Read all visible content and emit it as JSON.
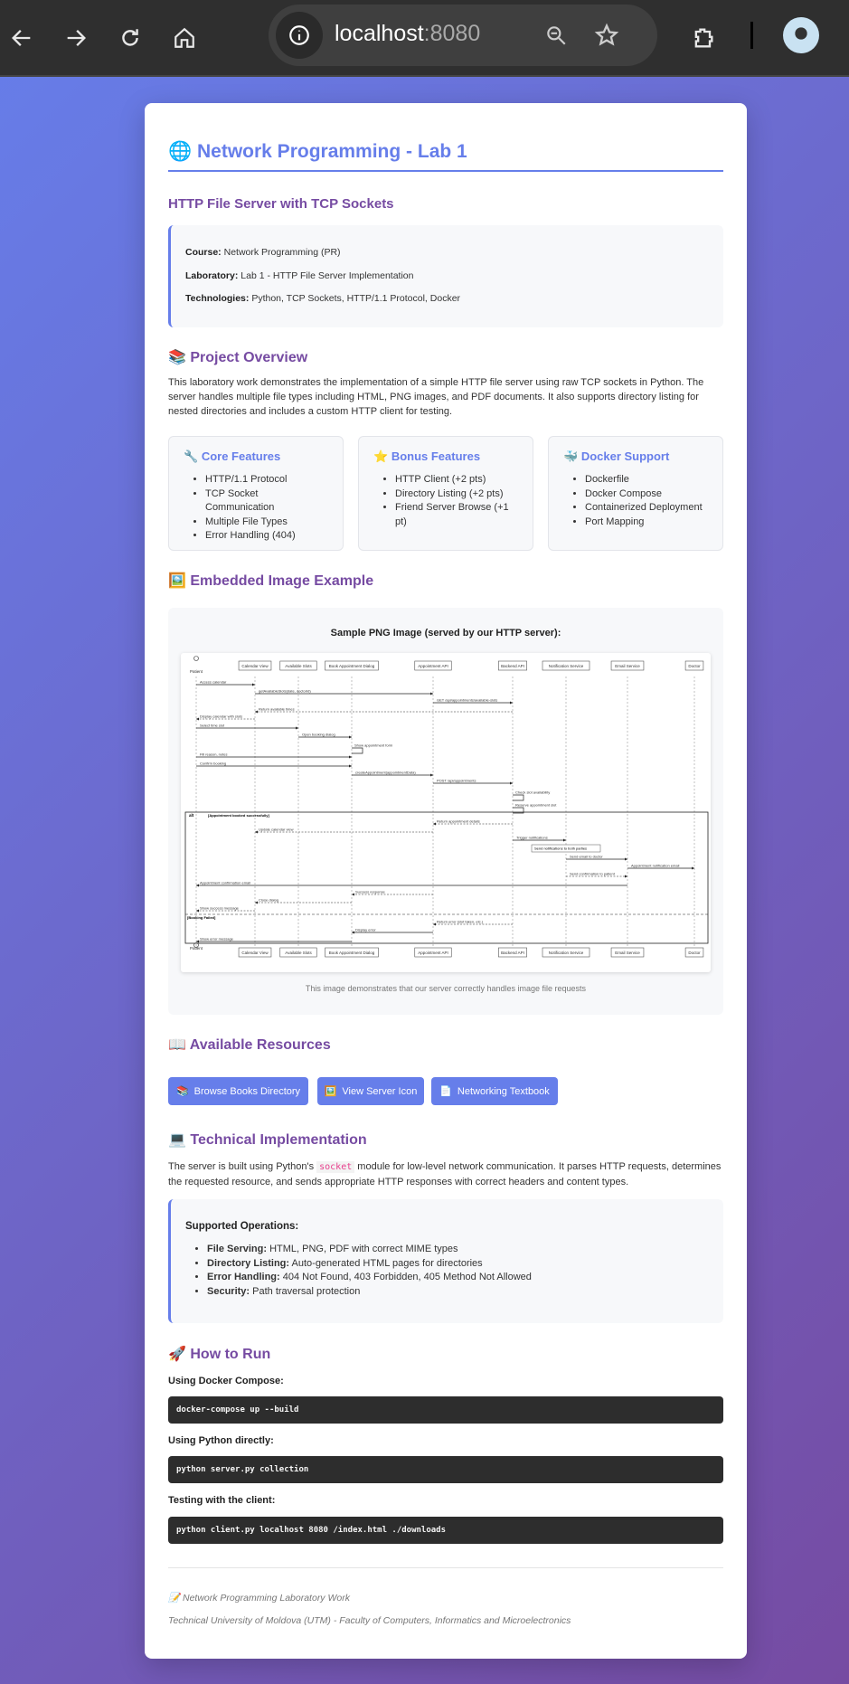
{
  "browser": {
    "url_host": "localhost",
    "url_port": ":8080"
  },
  "header": {
    "icon": "🌐",
    "title": "Network Programming - Lab 1",
    "subtitle": "HTTP File Server with TCP Sockets"
  },
  "info": [
    {
      "k": "Course:",
      "v": " Network Programming (PR)"
    },
    {
      "k": "Laboratory:",
      "v": " Lab 1 - HTTP File Server Implementation"
    },
    {
      "k": "Technologies:",
      "v": " Python, TCP Sockets, HTTP/1.1 Protocol, Docker"
    }
  ],
  "overview": {
    "icon": "📚",
    "title": "Project Overview",
    "text": "This laboratory work demonstrates the implementation of a simple HTTP file server using raw TCP sockets in Python. The server handles multiple file types including HTML, PNG images, and PDF documents. It also supports directory listing for nested directories and includes a custom HTTP client for testing."
  },
  "features": [
    {
      "icon": "🔧",
      "title": "Core Features",
      "items": [
        "HTTP/1.1 Protocol",
        "TCP Socket Communication",
        "Multiple File Types",
        "Error Handling (404)"
      ]
    },
    {
      "icon": "⭐",
      "title": "Bonus Features",
      "items": [
        "HTTP Client (+2 pts)",
        "Directory Listing (+2 pts)",
        "Friend Server Browse (+1 pt)"
      ]
    },
    {
      "icon": "🐳",
      "title": "Docker Support",
      "items": [
        "Dockerfile",
        "Docker Compose",
        "Containerized Deployment",
        "Port Mapping"
      ]
    }
  ],
  "embedded": {
    "icon": "🖼️",
    "title": "Embedded Image Example",
    "caption_title": "Sample PNG Image (served by our HTTP server):",
    "caption": "This image demonstrates that our server correctly handles image file requests"
  },
  "diagram": {
    "participants": [
      "Patient",
      "Calendar View",
      "Available Slots",
      "Book Appointment Dialog",
      "Appointment API",
      "Backend API",
      "Notification Service",
      "Email Service",
      "Doctor"
    ],
    "messages": [
      {
        "f": 0,
        "t": 1,
        "l": "Access calendar"
      },
      {
        "f": 1,
        "t": 4,
        "l": "getAvailableSlots(date, doctorId)"
      },
      {
        "f": 4,
        "t": 5,
        "l": "GET /api/appointments/available-slots"
      },
      {
        "f": 5,
        "t": 1,
        "l": "Return available times",
        "d": 1
      },
      {
        "f": 1,
        "t": 0,
        "l": "Display calendar with slots",
        "d": 1
      },
      {
        "f": 0,
        "t": 2,
        "l": "Select time slot"
      },
      {
        "f": 2,
        "t": 3,
        "l": "Open booking dialog"
      },
      {
        "f": 3,
        "t": 3,
        "l": "Show appointment form"
      },
      {
        "f": 0,
        "t": 3,
        "l": "Fill reason, notes"
      },
      {
        "f": 0,
        "t": 3,
        "l": "Confirm booking"
      },
      {
        "f": 3,
        "t": 4,
        "l": "createAppointment(appointmentData)"
      },
      {
        "f": 4,
        "t": 5,
        "l": "POST /api/appointments"
      },
      {
        "f": 5,
        "t": 5,
        "l": "Check slot availability"
      },
      {
        "f": 5,
        "t": 5,
        "l": "Reserve appointment slot"
      },
      {
        "f": 5,
        "t": 4,
        "l": "Return appointment details",
        "d": 1
      },
      {
        "f": 4,
        "t": 1,
        "l": "Update calendar view",
        "d": 1
      },
      {
        "f": 5,
        "t": 6,
        "l": "Trigger notifications"
      },
      {
        "f": 6,
        "t": 7,
        "l": "Send email to doctor"
      },
      {
        "f": 7,
        "t": 8,
        "l": "Appointment notification email"
      },
      {
        "f": 6,
        "t": 7,
        "l": "Send confirmation to patient",
        "d": 1
      },
      {
        "f": 7,
        "t": 0,
        "l": "Appointment confirmation email"
      },
      {
        "f": 4,
        "t": 3,
        "l": "Success response",
        "d": 1
      },
      {
        "f": 3,
        "t": 1,
        "l": "Close dialog",
        "d": 1
      },
      {
        "f": 1,
        "t": 0,
        "l": "Show success message",
        "d": 1
      },
      {
        "f": 5,
        "t": 4,
        "l": "Return error (slot taken, etc.)",
        "d": 1
      },
      {
        "f": 4,
        "t": 3,
        "l": "Display error"
      },
      {
        "f": 3,
        "t": 0,
        "l": "Show error message"
      }
    ],
    "alt_label": "alt",
    "alt_condition": "[Appointment booked successfully]",
    "else_condition": "[Booking Failed]",
    "note": "Send notifications to both parties"
  },
  "resources": {
    "icon": "📖",
    "title": "Available Resources",
    "buttons": [
      {
        "icon": "📚",
        "label": "Browse Books Directory"
      },
      {
        "icon": "🖼️",
        "label": "View Server Icon"
      },
      {
        "icon": "📄",
        "label": "Networking Textbook"
      }
    ]
  },
  "technical": {
    "icon": "💻",
    "title": "Technical Implementation",
    "text_before": "The server is built using Python's ",
    "code": "socket",
    "text_after": " module for low-level network communication. It parses HTTP requests, determines the requested resource, and sends appropriate HTTP responses with correct headers and content types.",
    "ops_title": "Supported Operations:",
    "ops": [
      {
        "k": "File Serving:",
        "v": " HTML, PNG, PDF with correct MIME types"
      },
      {
        "k": "Directory Listing:",
        "v": " Auto-generated HTML pages for directories"
      },
      {
        "k": "Error Handling:",
        "v": " 404 Not Found, 403 Forbidden, 405 Method Not Allowed"
      },
      {
        "k": "Security:",
        "v": " Path traversal protection"
      }
    ]
  },
  "run": {
    "icon": "🚀",
    "title": "How to Run",
    "steps": [
      {
        "label": "Using Docker Compose:",
        "cmd": "docker-compose up --build"
      },
      {
        "label": "Using Python directly:",
        "cmd": "python server.py collection"
      },
      {
        "label": "Testing with the client:",
        "cmd": "python client.py localhost 8080 /index.html ./downloads"
      }
    ]
  },
  "footer": {
    "icon": "📝",
    "line1": "Network Programming Laboratory Work",
    "line2": "Technical University of Moldova (UTM) - Faculty of Computers, Informatics and Microelectronics"
  }
}
